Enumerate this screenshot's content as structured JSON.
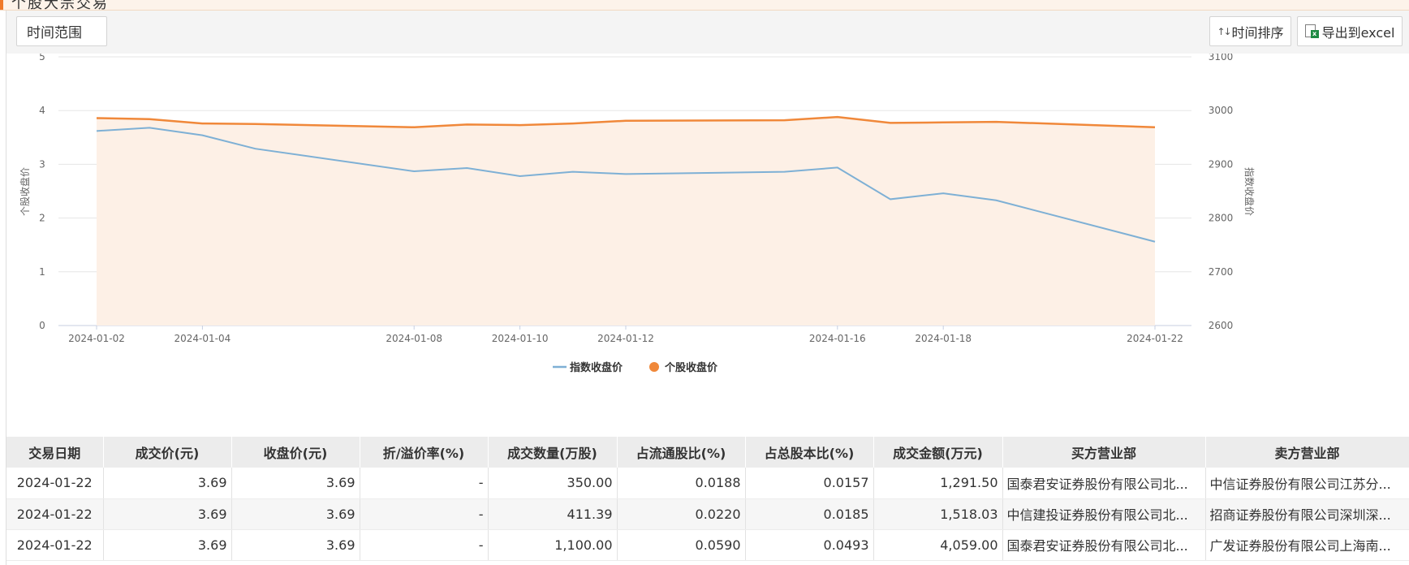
{
  "header": {
    "clipped_title": "个股大宗交易"
  },
  "toolbar": {
    "time_range_label": "时间范围",
    "sort_label": "时间排序",
    "sort_icon": "sort-arrows-icon",
    "export_label": "导出到excel",
    "export_icon": "excel-file-icon"
  },
  "chart_data": {
    "type": "line",
    "x": [
      "2024-01-02",
      "2024-01-03",
      "2024-01-04",
      "2024-01-05",
      "2024-01-08",
      "2024-01-09",
      "2024-01-10",
      "2024-01-11",
      "2024-01-12",
      "2024-01-15",
      "2024-01-16",
      "2024-01-17",
      "2024-01-18",
      "2024-01-19",
      "2024-01-22"
    ],
    "x_tick_labels": [
      "2024-01-02",
      "2024-01-04",
      "2024-01-08",
      "2024-01-10",
      "2024-01-12",
      "2024-01-16",
      "2024-01-18",
      "2024-01-22"
    ],
    "y_left": {
      "label": "个股收盘价",
      "range": [
        0,
        5
      ],
      "ticks": [
        "0",
        "1",
        "2",
        "3",
        "4",
        "5"
      ]
    },
    "y_right": {
      "label": "指数收盘价",
      "range": [
        2600,
        3100
      ],
      "ticks": [
        "2600",
        "2700",
        "2800",
        "2900",
        "3000",
        "3100"
      ]
    },
    "series": [
      {
        "name": "指数收盘价",
        "axis": "right",
        "color": "#7eb0d5",
        "marker": "line",
        "values": [
          2962,
          2968,
          2954,
          2929,
          2887,
          2893,
          2878,
          2886,
          2882,
          2886,
          2894,
          2835,
          2846,
          2833,
          2756
        ]
      },
      {
        "name": "个股收盘价",
        "axis": "left",
        "color": "#f0883a",
        "area_fill": "#fdf0e6",
        "marker": "circle",
        "values": [
          3.86,
          3.84,
          3.76,
          3.75,
          3.69,
          3.74,
          3.73,
          3.76,
          3.81,
          3.82,
          3.88,
          3.77,
          3.78,
          3.79,
          3.69
        ]
      }
    ],
    "grid": true,
    "legend_position": "bottom-center"
  },
  "table": {
    "columns": [
      "交易日期",
      "成交价(元)",
      "收盘价(元)",
      "折/溢价率(%)",
      "成交数量(万股)",
      "占流通股比(%)",
      "占总股本比(%)",
      "成交金额(万元)",
      "买方营业部",
      "卖方营业部"
    ],
    "rows": [
      [
        "2024-01-22",
        "3.69",
        "3.69",
        "-",
        "350.00",
        "0.0188",
        "0.0157",
        "1,291.50",
        "国泰君安证券股份有限公司北...",
        "中信证券股份有限公司江苏分..."
      ],
      [
        "2024-01-22",
        "3.69",
        "3.69",
        "-",
        "411.39",
        "0.0220",
        "0.0185",
        "1,518.03",
        "中信建投证券股份有限公司北...",
        "招商证券股份有限公司深圳深..."
      ],
      [
        "2024-01-22",
        "3.69",
        "3.69",
        "-",
        "1,100.00",
        "0.0590",
        "0.0493",
        "4,059.00",
        "国泰君安证券股份有限公司北...",
        "广发证券股份有限公司上海南..."
      ]
    ]
  }
}
